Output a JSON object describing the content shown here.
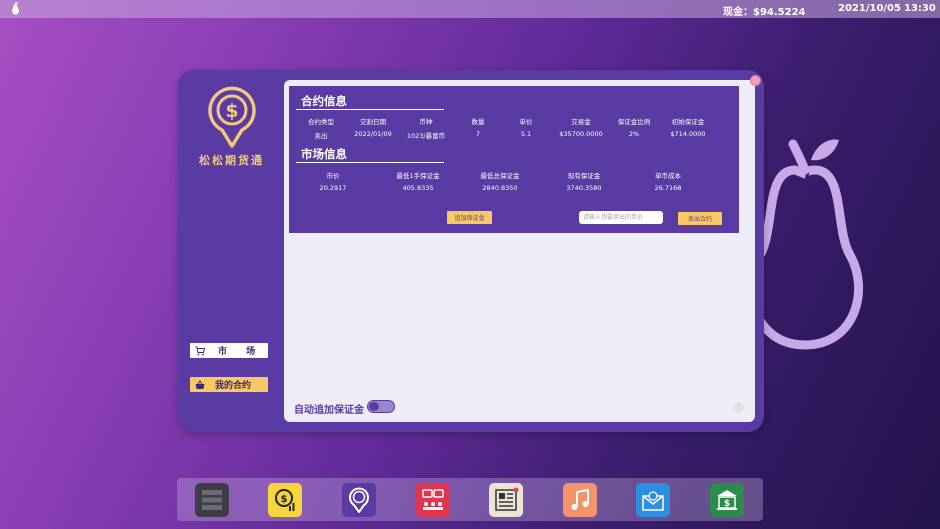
{
  "topbar": {
    "cash": "现金：$94.5224",
    "date": "2021/10/05",
    "time": "13:30"
  },
  "app": {
    "brand": "松松期货通",
    "nav": {
      "market": "市 场",
      "my_contracts": "我的合约"
    }
  },
  "contract_info": {
    "title": "合约信息",
    "headers": [
      "合约类型",
      "交割日期",
      "币种",
      "数量",
      "单价",
      "交易金",
      "保证金比例",
      "初始保证金"
    ],
    "values": [
      "卖出",
      "2022/01/09",
      "1023/暴富币",
      "7",
      "5.1",
      "$35700.0000",
      "2%",
      "$714.0000"
    ]
  },
  "market_info": {
    "title": "市场信息",
    "headers": [
      "市价",
      "最低1手保证金",
      "最低总保证金",
      "现有保证金",
      "单币成本"
    ],
    "values": [
      "20.2917",
      "405.8335",
      "2840.8350",
      "3740.3580",
      "26.7168"
    ]
  },
  "actions": {
    "add_margin": "追加保证金",
    "price_placeholder": "请输入想要卖出的单价",
    "sell_contract": "卖出合约"
  },
  "auto_margin": {
    "label": "自动追加保证金",
    "enabled": false
  },
  "help": "?",
  "dock": [
    "server-icon",
    "finance-chart-icon",
    "futures-app-icon",
    "chat-icon",
    "news-icon",
    "music-icon",
    "mail-icon",
    "bank-icon"
  ],
  "colors": {
    "primary": "#5a3aa3",
    "accent": "#f8c963",
    "panel": "#eeeef8"
  }
}
